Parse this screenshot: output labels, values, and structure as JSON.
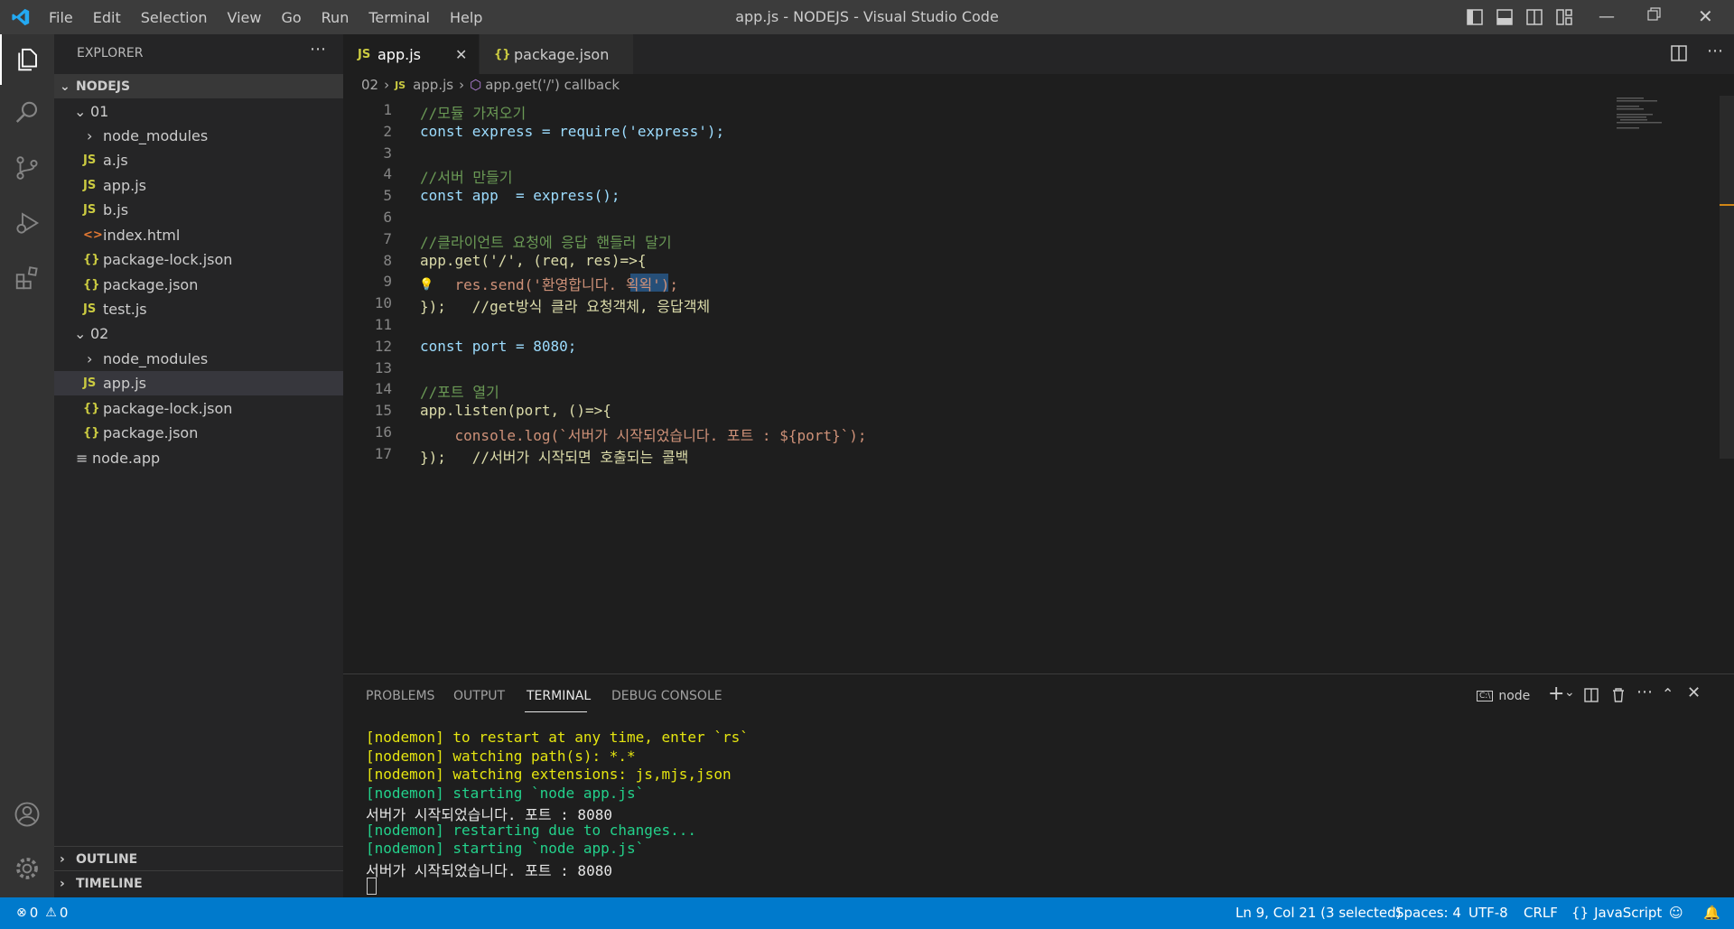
{
  "window": {
    "title": "app.js - NODEJS - Visual Studio Code"
  },
  "menu": [
    "File",
    "Edit",
    "Selection",
    "View",
    "Go",
    "Run",
    "Terminal",
    "Help"
  ],
  "sidebar": {
    "title": "EXPLORER",
    "root": "NODEJS",
    "folder1": "01",
    "folder1_items": [
      "node_modules",
      "a.js",
      "app.js",
      "b.js",
      "index.html",
      "package-lock.json",
      "package.json",
      "test.js"
    ],
    "folder2": "02",
    "folder2_items": [
      "node_modules",
      "app.js",
      "package-lock.json",
      "package.json"
    ],
    "loose_file": "node.app",
    "outline": "OUTLINE",
    "timeline": "TIMELINE"
  },
  "tabs": [
    {
      "label": "app.js",
      "active": true
    },
    {
      "label": "package.json",
      "active": false
    }
  ],
  "breadcrumb": {
    "folder": "02",
    "file": "app.js",
    "symbol": "app.get('/') callback"
  },
  "editor": {
    "line_numbers": [
      "1",
      "2",
      "3",
      "4",
      "5",
      "6",
      "7",
      "8",
      "9",
      "10",
      "11",
      "12",
      "13",
      "14",
      "15",
      "16",
      "17"
    ],
    "lines": [
      "//모듈 가져오기",
      "const express = require('express');",
      "",
      "//서버 만들기",
      "const app  = express();",
      "",
      "//클라이언트 요청에 응답 핸들러 달기",
      "app.get('/', (req, res)=>{",
      "    res.send('환영합니다. 왹왹');",
      "});   //get방식 클라 요청객체, 응답객체",
      "",
      "const port = 8080;",
      "",
      "//포트 열기",
      "app.listen(port, ()=>{",
      "    console.log(`서버가 시작되었습니다. 포트 : ${port}`);",
      "});   //서버가 시작되면 호출되는 콜백"
    ]
  },
  "panel": {
    "tabs": [
      "PROBLEMS",
      "OUTPUT",
      "TERMINAL",
      "DEBUG CONSOLE"
    ],
    "active_tab": "TERMINAL",
    "terminal_name": "node",
    "terminal_lines": [
      "[nodemon] to restart at any time, enter `rs`",
      "[nodemon] watching path(s): *.*",
      "[nodemon] watching extensions: js,mjs,json",
      "[nodemon] starting `node app.js`",
      "서버가 시작되었습니다. 포트 : 8080",
      "[nodemon] restarting due to changes...",
      "[nodemon] starting `node app.js`",
      "서버가 시작되었습니다. 포트 : 8080"
    ]
  },
  "status": {
    "errors": "0",
    "warnings": "0",
    "position": "Ln 9, Col 21 (3 selected)",
    "spaces": "Spaces: 4",
    "encoding": "UTF-8",
    "eol": "CRLF",
    "language": "JavaScript"
  },
  "colors": {
    "accent": "#007acc",
    "activity_bar": "#333333",
    "sidebar": "#252526",
    "editor": "#1e1e1e"
  }
}
